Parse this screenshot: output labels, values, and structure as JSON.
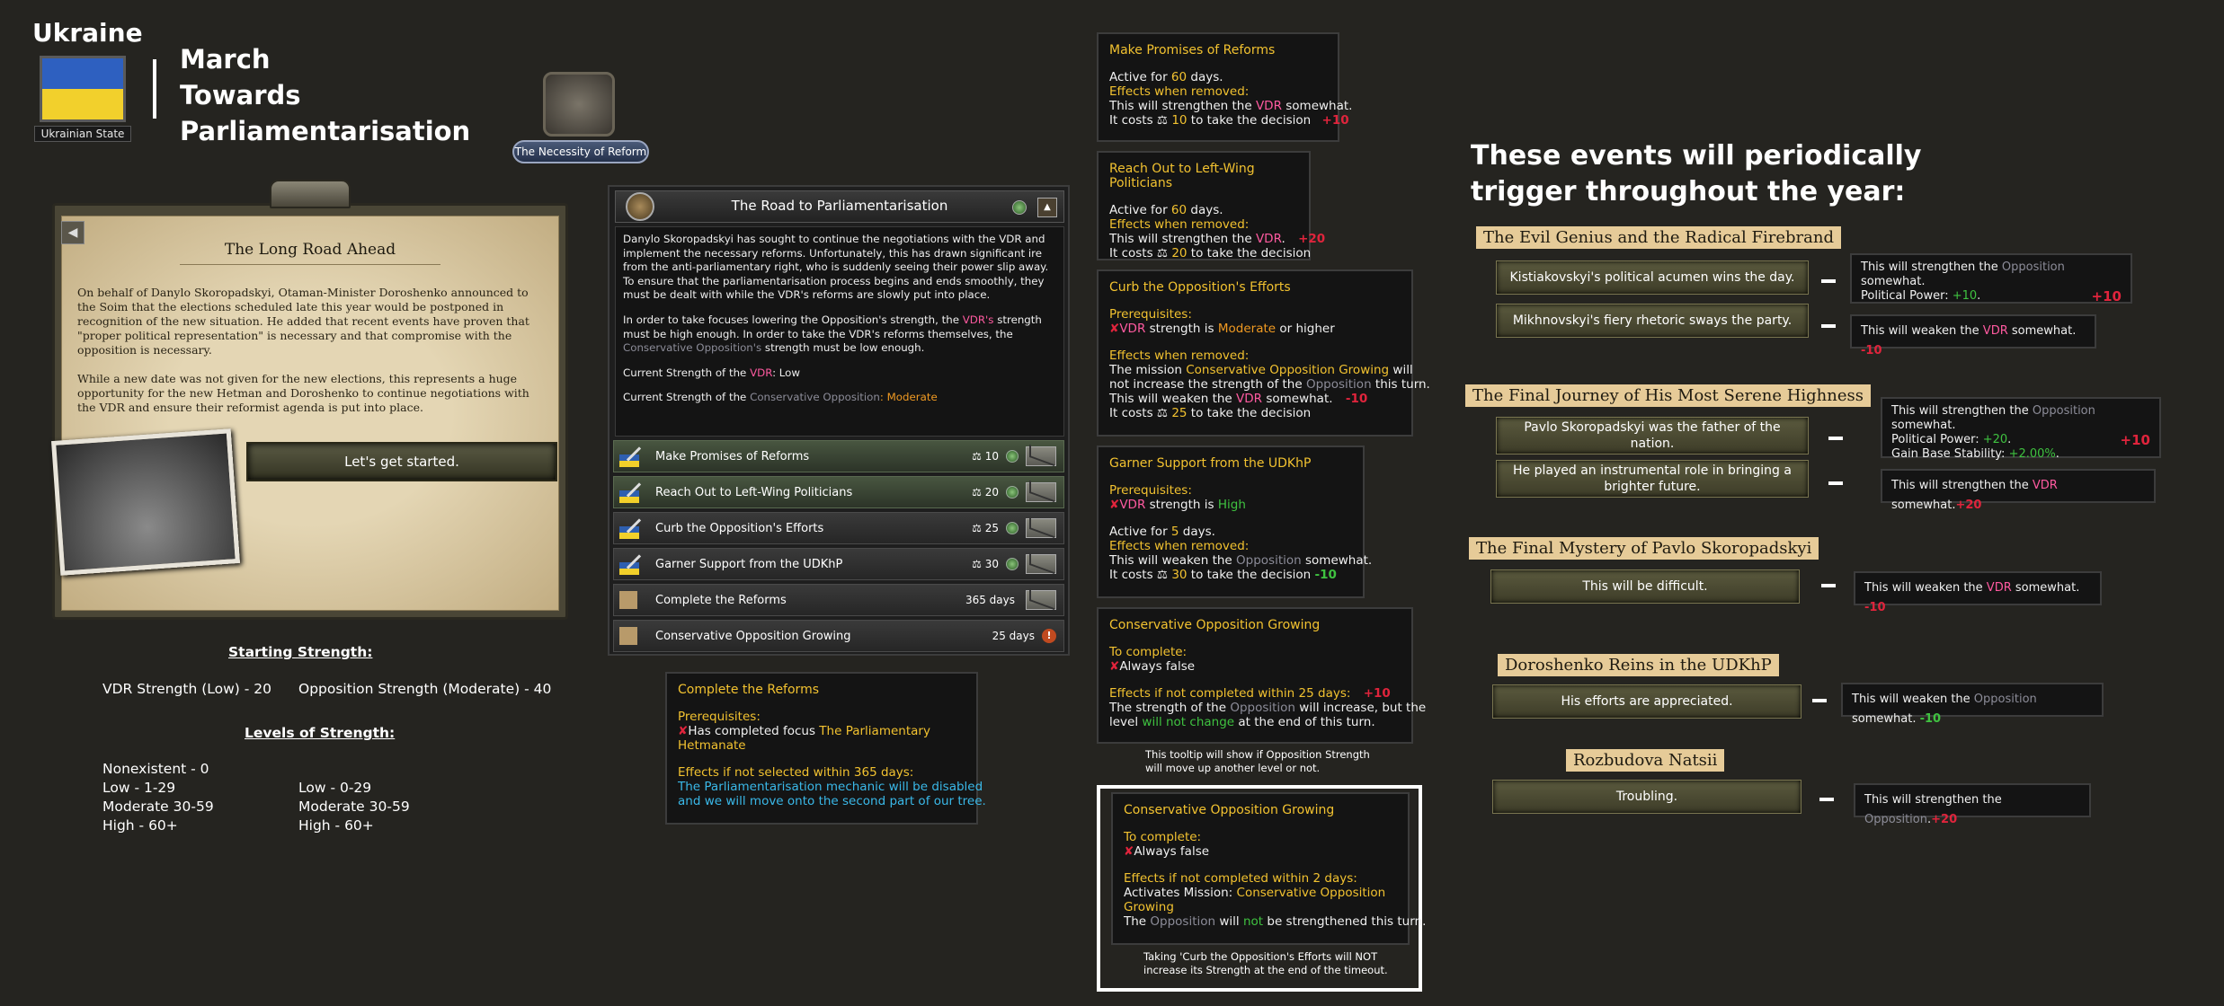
{
  "header": {
    "country": "Ukraine",
    "state_label": "Ukrainian State",
    "title_line1": "March",
    "title_line2": "Towards",
    "title_line3": "Parliamentarisation",
    "focus_label": "The Necessity of Reform"
  },
  "event": {
    "title": "The Long Road Ahead",
    "para1": "On behalf of Danylo Skoropadskyi, Otaman-Minister Doroshenko announced to the Soim that the elections scheduled late this year would be postponed in recognition of the new situation. He added that recent events have proven that \"proper political representation\" is necessary and that compromise with the opposition is necessary.",
    "para2": "While a new date was not given for the new elections, this represents a huge opportunity for the new Hetman and Doroshenko to continue negotiations with the VDR and ensure their reformist agenda is put into place.",
    "button": "Let's get started."
  },
  "strength": {
    "starting_title": "Starting Strength:",
    "vdr": "VDR Strength (Low) - 20",
    "opp": "Opposition Strength (Moderate) - 40",
    "levels_title": "Levels of Strength:",
    "nonexistent": "Nonexistent - 0",
    "vdr_levels": [
      "Low - 1-29",
      "Moderate 30-59",
      "High - 60+"
    ],
    "opp_levels": [
      "Low - 0-29",
      "Moderate 30-59",
      "High - 60+"
    ]
  },
  "decisions": {
    "title": "The Road to Parliamentarisation",
    "desc1": "Danylo Skoropadskyi has sought to continue the negotiations with the VDR and implement the necessary reforms. Unfortunately, this has drawn significant ire from the anti-parliamentary right, who is suddenly seeing their power slip away. To ensure that the parliamentarisation process begins and ends smoothly, they must be dealt with while the VDR's reforms are slowly put into place.",
    "desc2a": "In order to take focuses lowering the Opposition's strength, the ",
    "desc2b": "VDR's",
    "desc2c": " strength must be high enough. In order to take the VDR's reforms themselves, the ",
    "desc2d": "Conservative Opposition's",
    "desc2e": " strength must be low enough.",
    "cur_vdr_a": "Current Strength of the ",
    "cur_vdr_b": "VDR",
    "cur_vdr_c": ": Low",
    "cur_opp_a": "Current Strength of the ",
    "cur_opp_b": "Conservative Opposition",
    "cur_opp_c": ": Moderate",
    "items": [
      {
        "label": "Make Promises of Reforms",
        "cost": "10"
      },
      {
        "label": "Reach Out to Left-Wing Politicians",
        "cost": "20"
      },
      {
        "label": "Curb the Opposition's Efforts",
        "cost": "25"
      },
      {
        "label": "Garner Support from the UDKhP",
        "cost": "30"
      },
      {
        "label": "Complete the Reforms",
        "days": "365 days"
      },
      {
        "label": "Conservative Opposition Growing",
        "days": "25 days"
      }
    ]
  },
  "complete_reforms": {
    "title": "Complete the Reforms",
    "prereq": "Prerequisites:",
    "l1": "Has completed focus ",
    "l1b": "The Parliamentary",
    "l1c": "Hetmanate",
    "eff": "Effects if not selected within 365 days:",
    "e1": "The Parliamentarisation mechanic will be disabled",
    "e2": "and we will move onto the second part of our tree."
  },
  "tooltips": {
    "t1": {
      "title": "Make Promises of Reforms",
      "a1": "Active for ",
      "a2": "60",
      "a3": " days.",
      "eff": "Effects when removed:",
      "s1": "This will strengthen the ",
      "s2": "VDR",
      "s3": " somewhat.",
      "c1": "It costs ",
      "c2": "10",
      "c3": " to take the decision",
      "val": "+10"
    },
    "t2": {
      "title": "Reach Out to Left-Wing Politicians",
      "a1": "Active for ",
      "a2": "60",
      "a3": " days.",
      "eff": "Effects when removed:",
      "s1": "This will strengthen the ",
      "s2": "VDR",
      "s3": ".",
      "val": "+20",
      "c1": "It costs ",
      "c2": "20",
      "c3": " to take the decision"
    },
    "t3": {
      "title": "Curb the Opposition's Efforts",
      "prereq": "Prerequisites:",
      "p1": "VDR",
      "p2": " strength is ",
      "p3": "Moderate",
      "p4": " or higher",
      "eff": "Effects when removed:",
      "m1": "The mission ",
      "m2": "Conservative Opposition Growing",
      "m3": " will",
      "m4": "not increase the strength of the ",
      "m5": "Opposition",
      "m6": " this turn.",
      "w1": "This will weaken the ",
      "w2": "VDR",
      "w3": " somewhat.",
      "val": "-10",
      "c1": "It costs ",
      "c2": "25",
      "c3": " to take the decision"
    },
    "t4": {
      "title": "Garner Support from the UDKhP",
      "prereq": "Prerequisites:",
      "p1": "VDR",
      "p2": " strength is ",
      "p3": "High",
      "a1": "Active for ",
      "a2": "5",
      "a3": " days.",
      "eff": "Effects when removed:",
      "w1": "This will weaken the ",
      "w2": "Opposition",
      "w3": " somewhat.",
      "c1": "It costs ",
      "c2": "30",
      "c3": " to take the decision ",
      "val": "-10"
    },
    "t5": {
      "title": "Conservative Opposition Growing",
      "comp": "To complete:",
      "c1": "Always false",
      "eff": "Effects if not completed within 25 days:",
      "val": "+10",
      "e1": "The strength of the ",
      "e2": "Opposition",
      "e3": " will increase, but the",
      "e4": "level ",
      "e5": "will not change",
      "e6": " at the end of this turn.",
      "note1": "This tooltip will show if Opposition Strength",
      "note2": "will move up another level or not."
    },
    "t6": {
      "title": "Conservative Opposition Growing",
      "comp": "To complete:",
      "c1": "Always false",
      "eff": "Effects if not completed within 2 days:",
      "e1": "Activates Mission: ",
      "e2": "Conservative Opposition",
      "e3": "Growing",
      "e4": "The ",
      "e5": "Opposition",
      "e6": " will ",
      "e7": "not",
      "e8": " be strengthened this turn.",
      "note1": "Taking 'Curb the Opposition's Efforts will NOT",
      "note2": "increase its Strength at the end of the timeout."
    }
  },
  "events": {
    "heading1": "These events will periodically",
    "heading2": "trigger throughout the year:",
    "g1": {
      "title": "The Evil Genius and the Radical Firebrand",
      "o1": "Kistiakovskyi's political acumen wins the day.",
      "o2": "Mikhnovskyi's fiery rhetoric sways the party.",
      "e1a": "This will strengthen the ",
      "e1b": "Opposition",
      "e1c": " somewhat.",
      "e1d": "Political Power: ",
      "e1e": "+10",
      "e1f": ".",
      "e1v": "+10",
      "e2a": "This will weaken the ",
      "e2b": "VDR",
      "e2c": " somewhat.",
      "e2v": "-10"
    },
    "g2": {
      "title": "The Final Journey of His Most Serene Highness",
      "o1a": "Pavlo Skoropadskyi was the father of the",
      "o1b": "nation.",
      "o2a": "He played an instrumental role in bringing a",
      "o2b": "brighter future.",
      "e1a": "This will strengthen the ",
      "e1b": "Opposition",
      "e1c": " somewhat.",
      "e1d": "Political Power: ",
      "e1e": "+20",
      "e1f": ".",
      "e1g": "Gain Base Stability: ",
      "e1h": "+2.00%",
      "e1i": ".",
      "e1v": "+10",
      "e2a": "This will strengthen the ",
      "e2b": "VDR",
      "e2c": " somewhat.",
      "e2v": "+20"
    },
    "g3": {
      "title": "The Final Mystery of Pavlo Skoropadskyi",
      "o1": "This will be difficult.",
      "e1a": "This will weaken the ",
      "e1b": "VDR",
      "e1c": " somewhat. ",
      "e1v": "-10"
    },
    "g4": {
      "title": "Doroshenko Reins in the UDKhP",
      "o1": "His efforts are appreciated.",
      "e1a": "This will weaken the ",
      "e1b": "Opposition",
      "e1c": " somewhat. ",
      "e1v": "-10"
    },
    "g5": {
      "title": "Rozbudova Natsii",
      "o1": "Troubling.",
      "e1a": "This will strengthen the ",
      "e1b": "Opposition",
      "e1c": ".",
      "e1v": "+20"
    }
  }
}
